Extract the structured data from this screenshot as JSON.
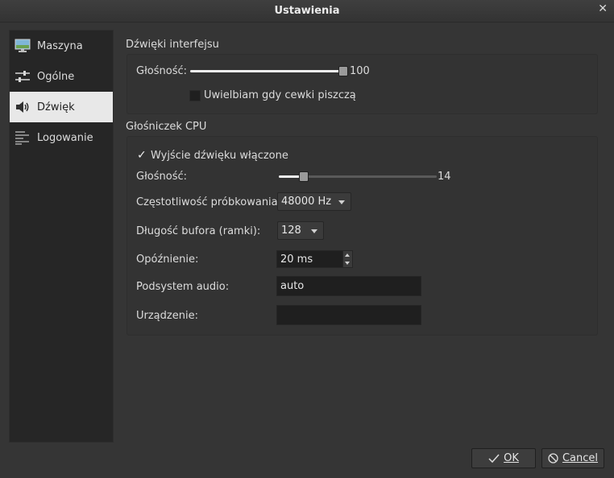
{
  "window": {
    "title": "Ustawienia",
    "close_glyph": "✕"
  },
  "sidebar": {
    "items": [
      {
        "label": "Maszyna",
        "icon": "monitor-icon"
      },
      {
        "label": "Ogólne",
        "icon": "sliders-icon"
      },
      {
        "label": "Dźwięk",
        "icon": "speaker-icon",
        "selected": true
      },
      {
        "label": "Logowanie",
        "icon": "log-lines-icon"
      }
    ]
  },
  "interface_sounds": {
    "title": "Dźwięki interfejsu",
    "volume_label": "Głośność:",
    "volume_value": "100",
    "volume_fraction": 1.0,
    "coil_whine_label": "Uwielbiam gdy cewki piszczą",
    "coil_whine_checked": false
  },
  "cpu_speaker": {
    "title": "Głośniczek CPU",
    "enabled_label": "Wyjście dźwięku włączone",
    "enabled_checked": true,
    "check_glyph": "✓",
    "volume_label": "Głośność:",
    "volume_value": "14",
    "volume_fraction": 0.16,
    "sample_rate_label": "Częstotliwość próbkowania:",
    "sample_rate_value": "48000 Hz",
    "buffer_label": "Długość bufora (ramki):",
    "buffer_value": "128",
    "latency_label": "Opóźnienie:",
    "latency_value": "20 ms",
    "audio_subsystem_label": "Podsystem audio:",
    "audio_subsystem_value": "auto",
    "device_label": "Urządzenie:",
    "device_value": ""
  },
  "buttons": {
    "ok_label": "OK",
    "cancel_label": "Cancel"
  },
  "colors": {
    "background": "#353535",
    "selected_item": "#e8e8e8",
    "field": "#1f1f1f"
  }
}
